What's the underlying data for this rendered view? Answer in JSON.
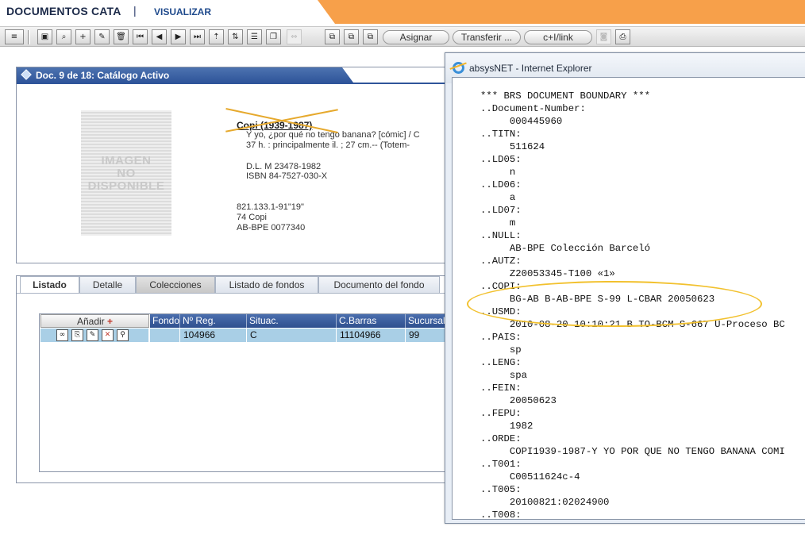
{
  "header": {
    "title": "DOCUMENTOS CATA",
    "separator": "|",
    "link": "VISUALIZAR"
  },
  "toolbar": {
    "icons": [
      "list-dropdown-icon",
      "view-icon",
      "search-icon",
      "add-icon",
      "edit-icon",
      "delete-icon",
      "first-icon",
      "prev-icon",
      "next-icon",
      "last-icon",
      "sort-icon",
      "sort-az-icon",
      "list-icon",
      "copy-icon",
      "link-icon",
      "window-icon",
      "window2-icon",
      "window3-icon"
    ],
    "glyphs": {
      "dropdown": "≡",
      "view": "▣",
      "search": "⌕",
      "add": "+",
      "edit": "✎",
      "delete": "🗑",
      "first": "⏮",
      "prev": "◀",
      "next": "▶",
      "last": "⏭",
      "sort": "⇡",
      "sortaz": "⇅",
      "list": "☰",
      "copy": "❐",
      "link": "⇔",
      "win1": "⧉",
      "win2": "⧉",
      "win3": "⧉",
      "camera": "◙",
      "export": "⎙"
    },
    "asignar": "Asignar",
    "transferir": "Transferir ...",
    "link_btn": "c+I/link"
  },
  "doc": {
    "title": "Doc. 9 de 18: Catálogo Activo",
    "no_image": [
      "IMAGEN",
      "NO",
      "DISPONIBLE"
    ],
    "author": "Copi (1939-1987)",
    "title_line": "Y yo, ¿por qué no tengo banana? [cómic] / C",
    "extent": "37 h. : principalmente il. ; 27 cm.-- (Totem-",
    "dl": "D.L. M 23478-1982",
    "isbn": "ISBN 84-7527-030-X",
    "cdu": "821.133.1-91\"19\"",
    "signature": "74 Copi",
    "register": "AB-BPE 0077340"
  },
  "tabs": [
    {
      "label": "Listado",
      "active": true
    },
    {
      "label": "Detalle",
      "active": false
    },
    {
      "label": "Colecciones",
      "active": false
    },
    {
      "label": "Listado de fondos",
      "active": false
    },
    {
      "label": "Documento del fondo",
      "active": false
    }
  ],
  "grid": {
    "add_label": "Añadir",
    "plus": "+",
    "columns": [
      "Fondo",
      "Nº Reg.",
      "Situac.",
      "C.Barras",
      "Sucursal"
    ],
    "row_icons": {
      "view": "∞",
      "doc": "⎘",
      "edit": "✎",
      "delete": "✕",
      "link": "⚲"
    },
    "rows": [
      {
        "fondo": "",
        "nreg": "104966",
        "situac": "C",
        "cbarras": "11104966",
        "sucursal": "99"
      }
    ]
  },
  "popup": {
    "title": "absysNET - Internet Explorer",
    "lines": [
      "*** BRS DOCUMENT BOUNDARY ***",
      "..Document-Number:",
      "     000445960",
      "..TITN:",
      "     511624",
      "..LD05:",
      "     n",
      "..LD06:",
      "     a",
      "..LD07:",
      "     m",
      "..NULL:",
      "     AB-BPE Colección Barceló",
      "..AUTZ:",
      "     Z20053345-T100 «1»",
      "..COPI:",
      "     BG-AB B-AB-BPE S-99 L-CBAR 20050623",
      "..USMD:",
      "     2010-08-20 10:10:21 B TO-BCM S-667 U-Proceso BC",
      "..PAIS:",
      "     sp",
      "..LENG:",
      "     spa",
      "..FEIN:",
      "     20050623",
      "..FEPU:",
      "     1982",
      "..ORDE:",
      "     COPI1939-1987-Y YO POR QUE NO TENGO BANANA COMI",
      "..T001:",
      "     C00511624c-4",
      "..T005:",
      "     20100821:02024900",
      "..T008:"
    ]
  },
  "colors": {
    "accent_orange": "#f7a04a",
    "header_blue": "#2f559a",
    "highlight_yellow": "#f2c12e",
    "row_blue": "#a9cfe6"
  }
}
